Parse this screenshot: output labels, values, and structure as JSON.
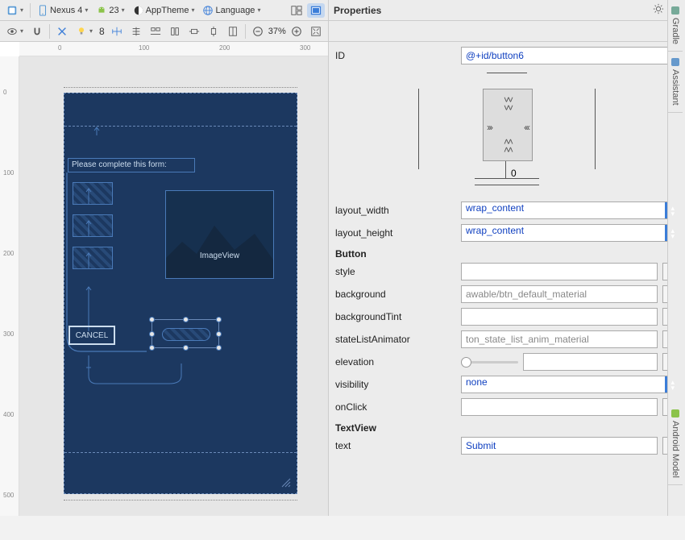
{
  "toolbar1": {
    "device": "Nexus 4",
    "api": "23",
    "theme": "AppTheme",
    "locale": "Language"
  },
  "toolbar2": {
    "autoconnect_value": "8",
    "zoom": "37%"
  },
  "rulers": {
    "h": [
      "0",
      "100",
      "200",
      "300"
    ],
    "v": [
      "0",
      "100",
      "200",
      "300",
      "400",
      "500"
    ]
  },
  "design": {
    "form_label": "Please complete this form:",
    "image_caption": "ImageView",
    "cancel": "CANCEL"
  },
  "properties": {
    "title": "Properties",
    "id_label": "ID",
    "id_value": "@+id/button6",
    "constraint_zero": "0",
    "layout_width_label": "layout_width",
    "layout_width_value": "wrap_content",
    "layout_height_label": "layout_height",
    "layout_height_value": "wrap_content",
    "button_section": "Button",
    "style_label": "style",
    "style_value": "",
    "background_label": "background",
    "background_value": "awable/btn_default_material",
    "backgroundTint_label": "backgroundTint",
    "backgroundTint_value": "",
    "stateListAnimator_label": "stateListAnimator",
    "stateListAnimator_value": "ton_state_list_anim_material",
    "elevation_label": "elevation",
    "elevation_value": "",
    "visibility_label": "visibility",
    "visibility_value": "none",
    "onClick_label": "onClick",
    "onClick_value": "",
    "textview_section": "TextView",
    "text_label": "text",
    "text_value": "Submit"
  },
  "side_tabs": {
    "gradle": "Gradle",
    "assistant": "Assistant",
    "android_model": "Android Model"
  }
}
